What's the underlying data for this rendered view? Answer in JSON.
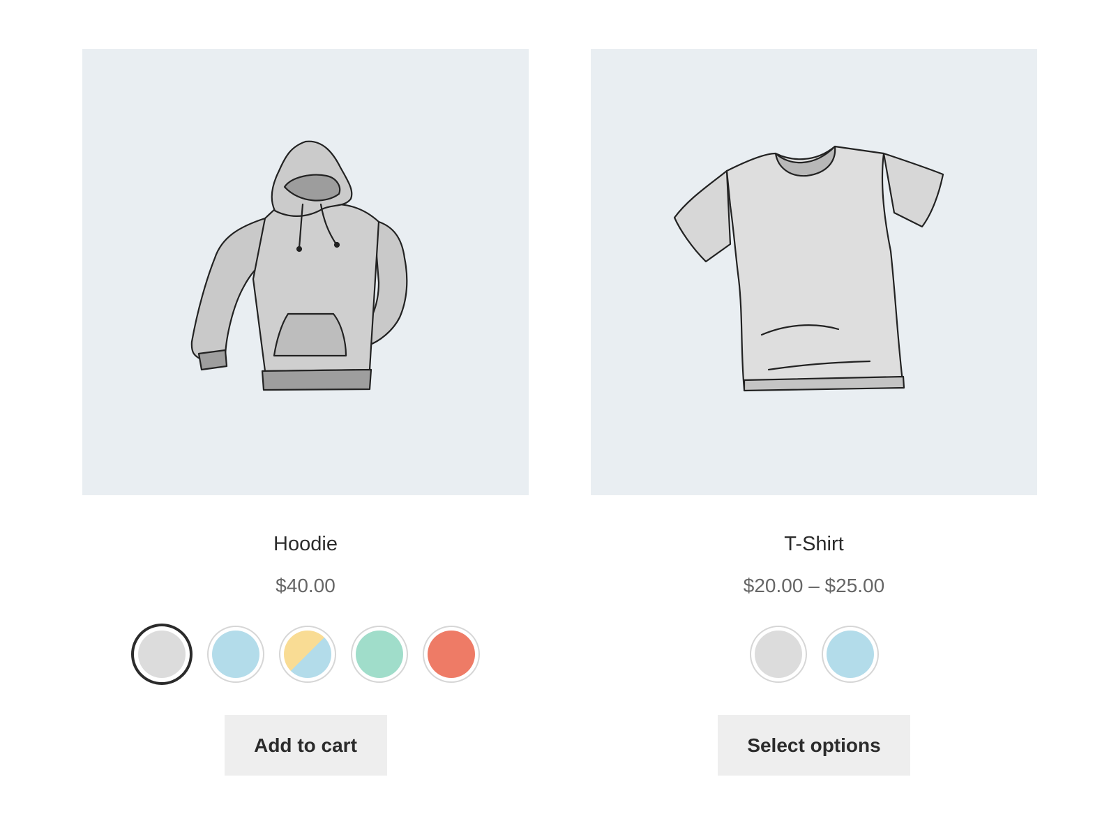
{
  "products": [
    {
      "title": "Hoodie",
      "price": "$40.00",
      "image_icon": "hoodie-illustration",
      "swatches": [
        {
          "color": "#dcdcdc",
          "selected": true
        },
        {
          "color": "#b3dcea",
          "selected": false
        },
        {
          "color": "split-yellow-blue",
          "top": "#f9dc94",
          "bottom": "#b3dcea",
          "selected": false
        },
        {
          "color": "#a0ddca",
          "selected": false
        },
        {
          "color": "#ee7b66",
          "selected": false
        }
      ],
      "button_label": "Add to cart"
    },
    {
      "title": "T-Shirt",
      "price": "$20.00 – $25.00",
      "image_icon": "tshirt-illustration",
      "swatches": [
        {
          "color": "#dcdcdc",
          "selected": false
        },
        {
          "color": "#b3dcea",
          "selected": false
        }
      ],
      "button_label": "Select options"
    }
  ],
  "colors": {
    "image_background": "#e9eef2",
    "button_background": "#eeeeee",
    "selected_ring": "#2b2b2b"
  }
}
